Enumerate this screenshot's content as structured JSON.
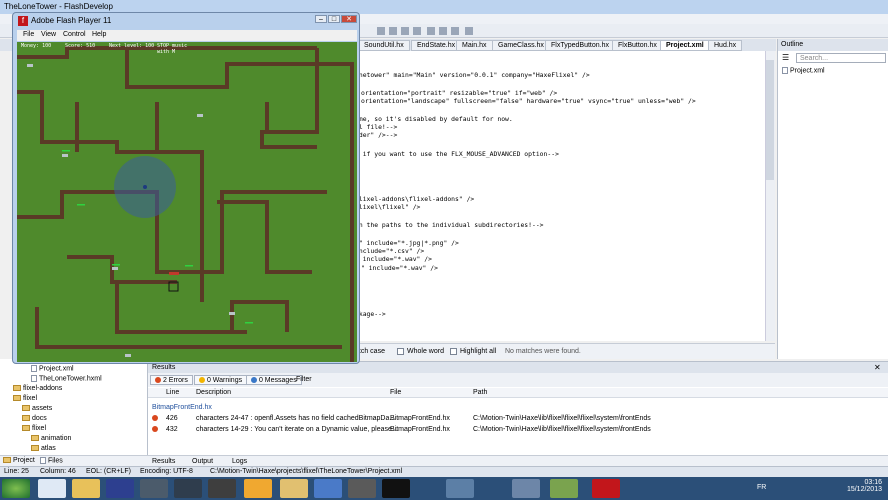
{
  "window": {
    "title": "TheLoneTower - FlashDevelop"
  },
  "tabs": [
    "SoundUtil.hx",
    "EndState.hx",
    "Main.hx",
    "GameClass.hx",
    "FlxTypedButton.hx",
    "FlxButton.hx",
    "Project.xml",
    "Hud.hx"
  ],
  "editor": {
    "lines": [
      "onetower\" main=\"Main\" version=\"0.0.1\" company=\"HaxeFlixel\" />",
      "",
      "orientation=\"portrait\" resizable=\"true\" if=\"web\" />",
      "orientation=\"landscape\" fullscreen=\"false\" hardware=\"true\" vsync=\"true\" unless=\"web\" />",
      "",
      "ome, so it's disabled by default for now.",
      "ml file!-->",
      "ader\" />-->",
      "",
      "2 if you want to use the FLX_MOUSE_ADVANCED option-->",
      "",
      "",
      "",
      "flixel-addons\\flixel-addons\" />",
      "flixel\\flixel\" />",
      "",
      "en the paths to the individual subdirectories!-->",
      "",
      "s\" include=\"*.jpg|*.png\" />",
      "include=\"*.csv\" />",
      "\" include=\"*.wav\" />",
      "\" include=\"*.wav\" />",
      "",
      "",
      "",
      "",
      "",
      "ckage-->"
    ]
  },
  "findbar": {
    "match_case": "atch case",
    "whole_word": "Whole word",
    "highlight_all": "Highlight all",
    "status": "No matches were found."
  },
  "outline": {
    "title": "Outline",
    "search_placeholder": "Search...",
    "item": "Project.xml"
  },
  "results": {
    "title": "Results",
    "errors": "2 Errors",
    "warnings": "0 Warnings",
    "messages": "0 Messages",
    "filter": "Filter",
    "columns": {
      "line": "Line",
      "description": "Description",
      "file": "File",
      "path": "Path"
    },
    "group": "BitmapFrontEnd.hx",
    "rows": [
      {
        "line": "426",
        "description": "characters 24-47 : openfl.Assets has no field cachedBitmapDa...",
        "file": "BitmapFrontEnd.hx",
        "path": "C:\\Motion-Twin\\Haxe\\lib\\flixel\\flixel\\flixel\\system\\frontEnds"
      },
      {
        "line": "432",
        "description": "characters 14-29 : You can't iterate on a Dynamic value, please...",
        "file": "BitmapFrontEnd.hx",
        "path": "C:\\Motion-Twin\\Haxe\\lib\\flixel\\flixel\\flixel\\system\\frontEnds"
      }
    ],
    "bottom_tabs": [
      "Results",
      "Output",
      "Logs"
    ]
  },
  "project_tree": [
    {
      "label": "Project.xml",
      "indent": 3,
      "kind": "file"
    },
    {
      "label": "TheLoneTower.hxml",
      "indent": 3,
      "kind": "file"
    },
    {
      "label": "flixel-addons",
      "indent": 1,
      "kind": "folder"
    },
    {
      "label": "flixel",
      "indent": 1,
      "kind": "folder"
    },
    {
      "label": "assets",
      "indent": 2,
      "kind": "folder"
    },
    {
      "label": "docs",
      "indent": 2,
      "kind": "folder"
    },
    {
      "label": "flixel",
      "indent": 2,
      "kind": "folder"
    },
    {
      "label": "animation",
      "indent": 3,
      "kind": "folder"
    },
    {
      "label": "atlas",
      "indent": 3,
      "kind": "folder"
    }
  ],
  "project_tabs": [
    "Project",
    "Files"
  ],
  "status": {
    "line": "Line: 25",
    "column": "Column: 46",
    "eol": "EOL: (CR+LF)",
    "encoding": "Encoding: UTF-8",
    "path": "C:\\Motion-Twin\\Haxe\\projects\\flixel\\TheLoneTower\\Project.xml"
  },
  "flash": {
    "title": "Adobe Flash Player 11",
    "menu": [
      "File",
      "View",
      "Control",
      "Help"
    ],
    "hud": {
      "money": "Money: 100",
      "score": "Score: 510",
      "next_level": "Next level: 100",
      "music": "STOP music",
      "music2": "with M"
    }
  },
  "clock": {
    "time": "03:16",
    "date": "15/12/2013",
    "lang": "FR"
  },
  "colors": {
    "grass": "#4f8a2c",
    "path": "#5a3a26",
    "accent": "#3a78c8"
  }
}
